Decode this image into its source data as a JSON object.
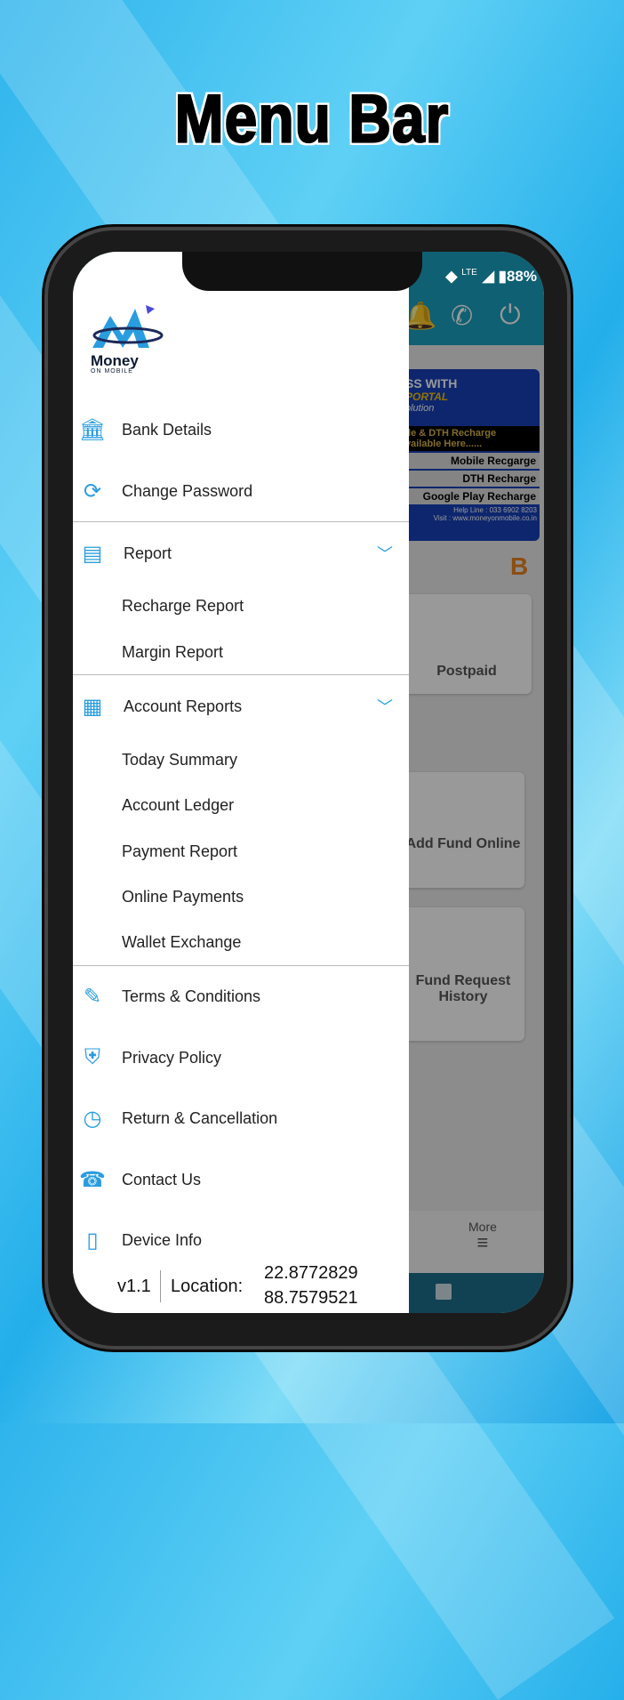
{
  "title": "Menu Bar",
  "status_bar": {
    "network": "LTE",
    "battery": "88%"
  },
  "drawer": {
    "logo": {
      "name": "Money",
      "tagline": "ON MOBILE"
    },
    "items": [
      {
        "label": "Bank Details",
        "icon": "bank-icon"
      },
      {
        "label": "Change Password",
        "icon": "password-icon"
      },
      {
        "label": "Report",
        "icon": "report-icon",
        "expanded": true,
        "children": [
          "Recharge Report",
          "Margin Report"
        ]
      },
      {
        "label": "Account Reports",
        "icon": "account-reports-icon",
        "expanded": true,
        "children": [
          "Today Summary",
          "Account Ledger",
          "Payment Report",
          "Online Payments",
          "Wallet Exchange"
        ]
      },
      {
        "label": "Terms & Conditions",
        "icon": "terms-icon"
      },
      {
        "label": "Privacy Policy",
        "icon": "shield-lock-icon"
      },
      {
        "label": "Return & Cancellation",
        "icon": "clock-icon"
      },
      {
        "label": "Contact Us",
        "icon": "contact-icon"
      },
      {
        "label": "Device Info",
        "icon": "device-icon"
      }
    ],
    "footer": {
      "version": "v1.1",
      "location_label": "Location:",
      "latitude": "22.8772829",
      "longitude": "88.7579521"
    }
  },
  "background_app": {
    "banner": {
      "line1": "SS WITH",
      "line2": "PORTAL",
      "line3": "olution",
      "line4": "ile & DTH Recharge",
      "line5": "vailable Here......",
      "rows": [
        "Mobile Recgarge",
        "DTH Recharge",
        "Google Play Recharge"
      ],
      "help": "Help Line : 033 6902 8203",
      "visit": "Visit : www.moneyonmobile.co.in"
    },
    "section_letter": "B",
    "cards": [
      "Postpaid",
      "Add Fund Online",
      "Fund Request History"
    ],
    "bottom_nav_more": "More"
  },
  "colors": {
    "accent": "#2a9de0",
    "header": "#1aa0c0",
    "orange": "#e8821e"
  }
}
